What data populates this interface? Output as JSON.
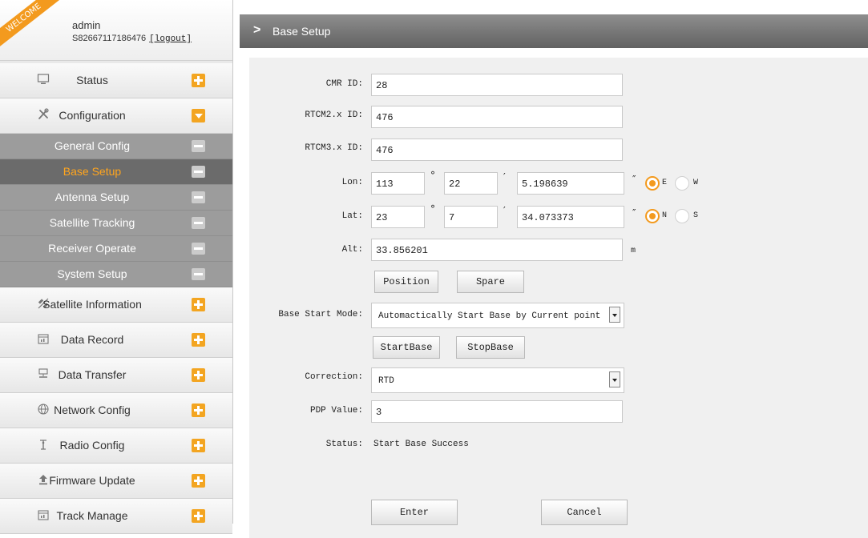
{
  "user": {
    "welcome": "WELCOME",
    "name": "admin",
    "serial": "S82667117186476",
    "logout": "[logout]"
  },
  "menu": [
    {
      "label": "Status",
      "icon": "monitor-icon"
    },
    {
      "label": "Configuration",
      "icon": "tools-icon"
    },
    {
      "label": "Satellite Information",
      "icon": "satellite-icon"
    },
    {
      "label": "Data Record",
      "icon": "calendar-icon"
    },
    {
      "label": "Data Transfer",
      "icon": "network-icon"
    },
    {
      "label": "Network Config",
      "icon": "globe-icon"
    },
    {
      "label": "Radio Config",
      "icon": "antenna-icon"
    },
    {
      "label": "Firmware Update",
      "icon": "upload-icon"
    },
    {
      "label": "Track Manage",
      "icon": "calendar-icon"
    }
  ],
  "submenu": [
    {
      "label": "General Config"
    },
    {
      "label": "Base Setup",
      "active": true
    },
    {
      "label": "Antenna Setup"
    },
    {
      "label": "Satellite Tracking"
    },
    {
      "label": "Receiver Operate"
    },
    {
      "label": "System Setup"
    }
  ],
  "page": {
    "title": "Base Setup"
  },
  "form": {
    "cmr_label": "CMR ID:",
    "cmr_value": "28",
    "rtcm2_label": "RTCM2.x ID:",
    "rtcm2_value": "476",
    "rtcm3_label": "RTCM3.x ID:",
    "rtcm3_value": "476",
    "lon_label": "Lon:",
    "lon_deg": "113",
    "lon_min": "22",
    "lon_sec": "5.198639",
    "lon_dir_e": "E",
    "lon_dir_w": "W",
    "lon_selected": "E",
    "lat_label": "Lat:",
    "lat_deg": "23",
    "lat_min": "7",
    "lat_sec": "34.073373",
    "lat_dir_n": "N",
    "lat_dir_s": "S",
    "lat_selected": "N",
    "deg_sym": "°",
    "min_sym": "′",
    "sec_sym": "″",
    "alt_label": "Alt:",
    "alt_value": "33.856201",
    "alt_unit": "m",
    "position_btn": "Position",
    "spare_btn": "Spare",
    "mode_label": "Base Start Mode:",
    "mode_value": "Automactically Start Base by Current point",
    "startbase_btn": "StartBase",
    "stopbase_btn": "StopBase",
    "correction_label": "Correction:",
    "correction_value": "RTD",
    "pdop_label": "PDP Value:",
    "pdop_value": "3",
    "status_label": "Status:",
    "status_value": "Start Base Success",
    "enter_btn": "Enter",
    "cancel_btn": "Cancel"
  },
  "colors": {
    "accent": "#f39a1e",
    "active_submenu_text": "#ffa51e"
  }
}
